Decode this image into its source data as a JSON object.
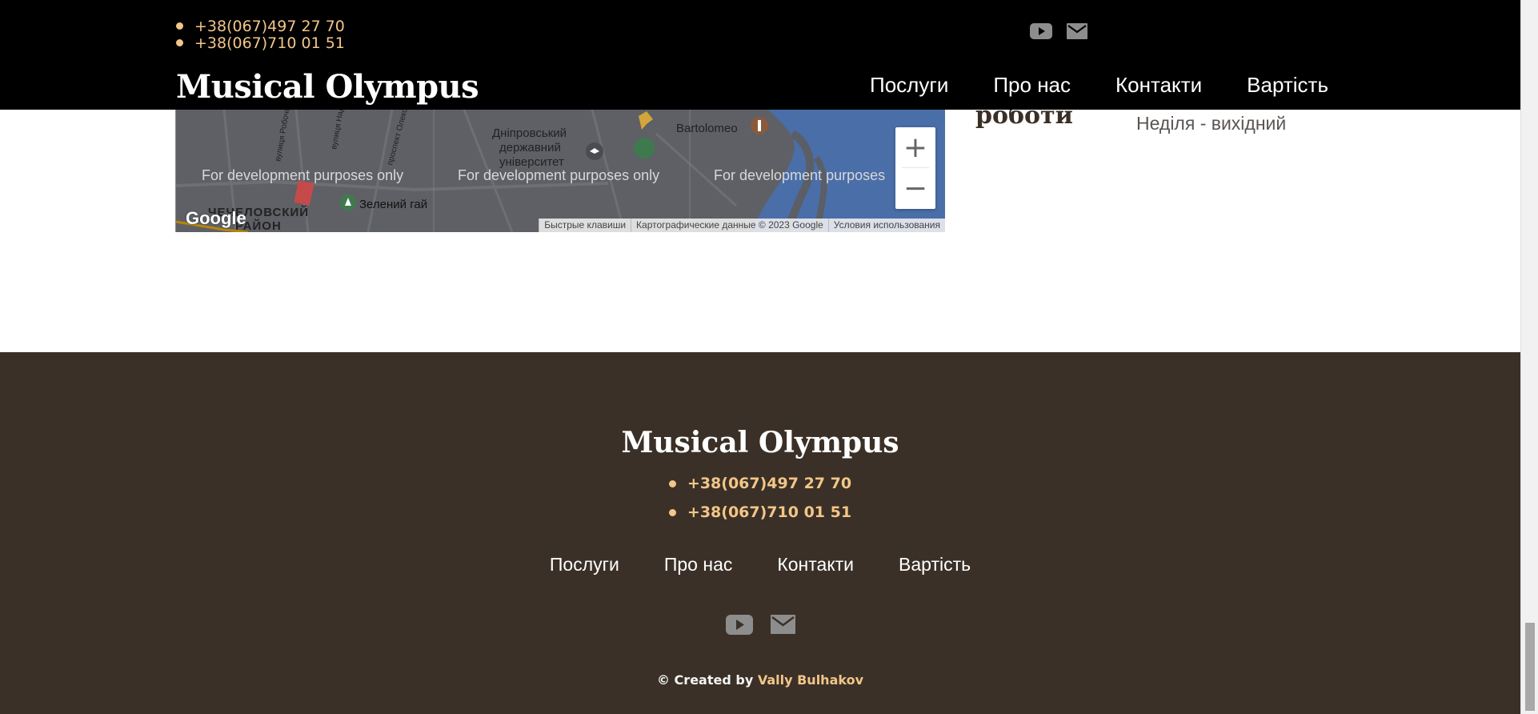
{
  "site": {
    "logo": "Musical Olympus",
    "accent": "#f2c689",
    "header_bg": "#000000",
    "footer_bg": "#3a3027"
  },
  "header": {
    "phones": [
      "+38(067)497 27 70",
      "+38(067)710 01 51"
    ],
    "social": [
      {
        "icon": "youtube-icon"
      },
      {
        "icon": "mail-icon"
      }
    ],
    "nav": [
      "Послуги",
      "Про нас",
      "Контакти",
      "Вартість"
    ]
  },
  "contacts_section": {
    "hours_heading": "роботи",
    "hours_value": "Неділя - вихідний",
    "map": {
      "dev_notice": "For development purposes only",
      "dev_notice_truncated": "For development purposes",
      "labels": [
        "Дніпровський",
        "державний",
        "університет",
        "Bartolomeo",
        "Зелений гай",
        "ЧЕЧЕЛОВСКИЙ",
        "РАЙОН",
        "вулиця Робоча",
        "вулиця Надії",
        "проспект Олексан"
      ],
      "zoom_in": "+",
      "zoom_out": "−",
      "google_logo": "Google",
      "attribution": [
        "Быстрые клавиши",
        "Картографические данные © 2023 Google",
        "Условия использования"
      ]
    }
  },
  "footer": {
    "logo": "Musical Olympus",
    "phones": [
      "+38(067)497 27 70",
      "+38(067)710 01 51"
    ],
    "nav": [
      "Послуги",
      "Про нас",
      "Контакти",
      "Вартість"
    ],
    "social": [
      {
        "icon": "youtube-icon"
      },
      {
        "icon": "mail-icon"
      }
    ],
    "credit_prefix": "© Created by",
    "credit_author": "Vally Bulhakov"
  }
}
